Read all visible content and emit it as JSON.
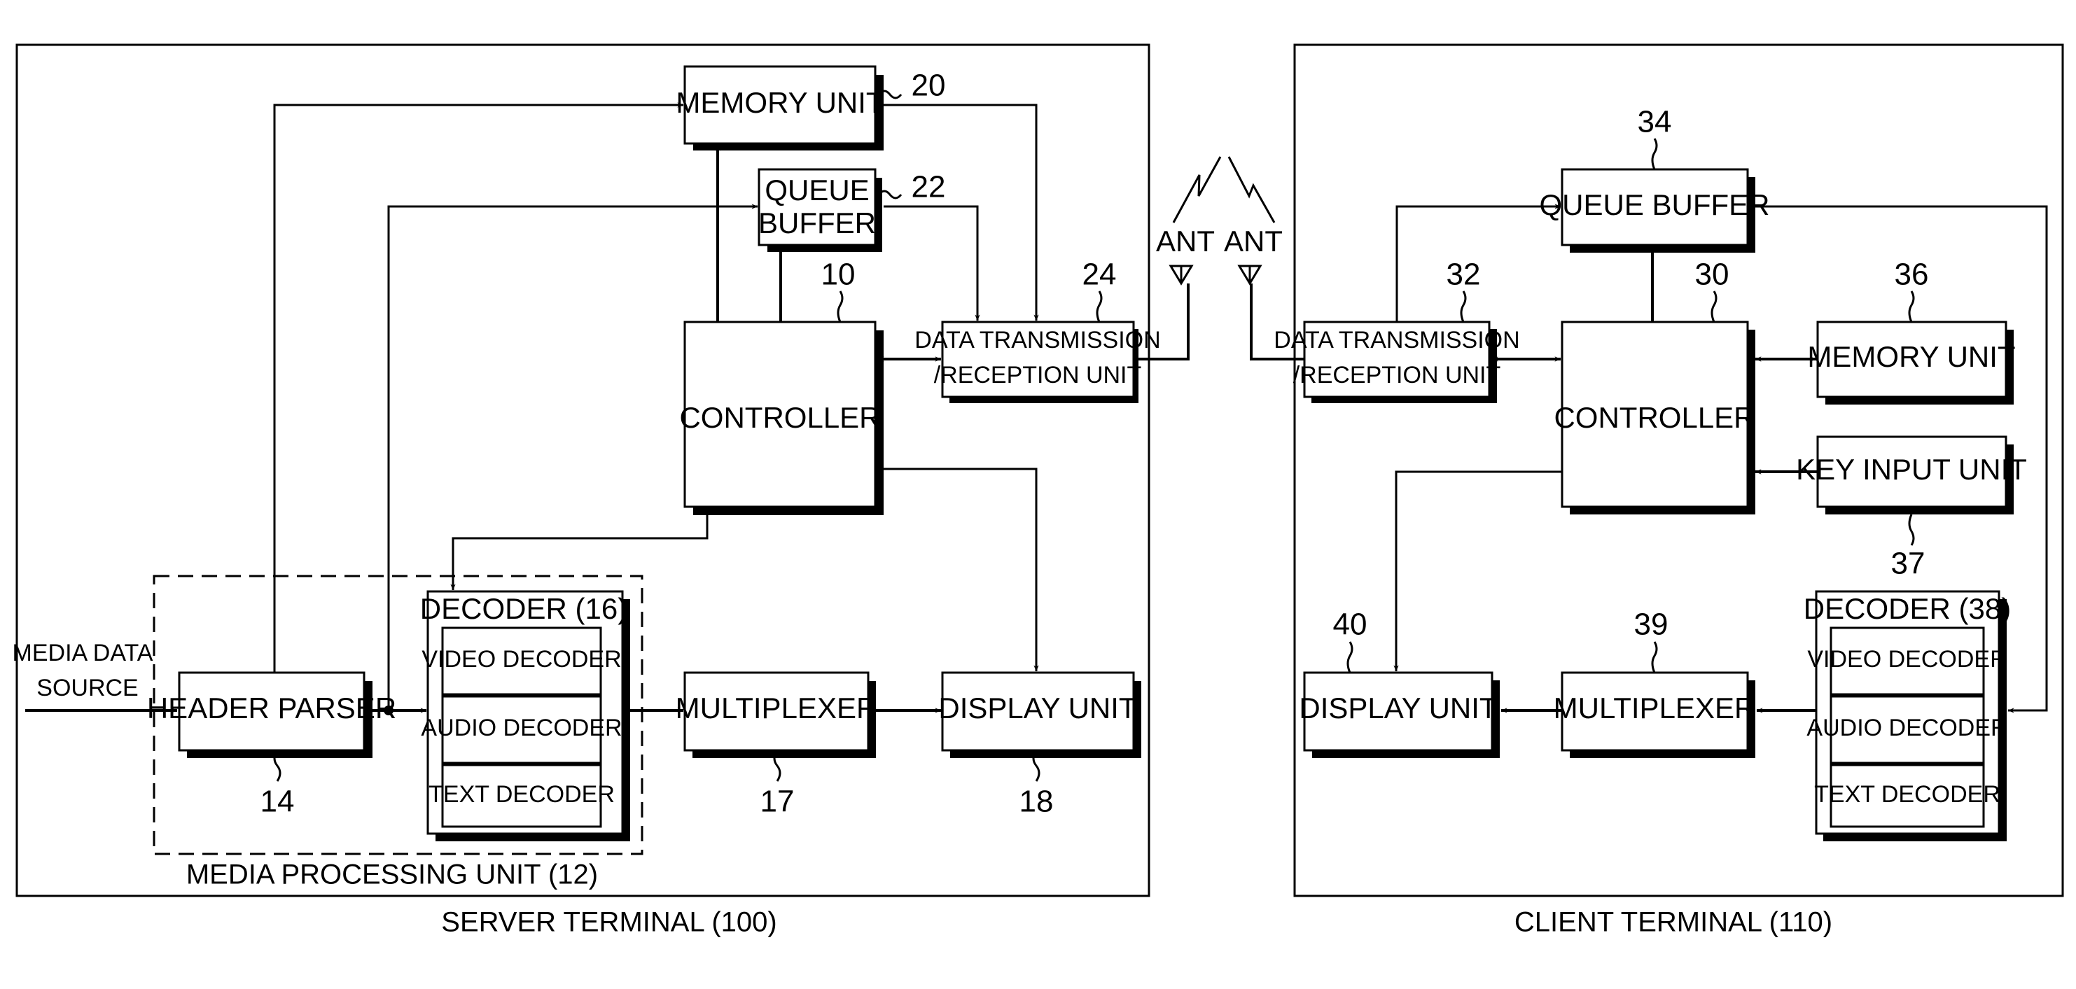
{
  "server": {
    "caption": "SERVER TERMINAL  (100)",
    "media_source": [
      "MEDIA DATA",
      "SOURCE"
    ],
    "memory_unit": {
      "label": "MEMORY UNIT",
      "ref": "20"
    },
    "queue_buffer": {
      "label": [
        "QUEUE",
        "BUFFER"
      ],
      "ref": "22"
    },
    "controller": {
      "label": "CONTROLLER",
      "ref": "10"
    },
    "data_tx": {
      "label": [
        "DATA TRANSMISSION",
        "/RECEPTION UNIT"
      ],
      "ref": "24"
    },
    "header_parser": {
      "label": "HEADER PARSER",
      "ref": "14"
    },
    "decoder": {
      "title": "DECODER (16)",
      "items": [
        "VIDEO DECODER",
        "AUDIO DECODER",
        "TEXT DECODER"
      ]
    },
    "media_processing_unit": "MEDIA PROCESSING UNIT (12)",
    "multiplexer": {
      "label": "MULTIPLEXER",
      "ref": "17"
    },
    "display_unit": {
      "label": "DISPLAY UNIT",
      "ref": "18"
    }
  },
  "antennas": {
    "left": "ANT",
    "right": "ANT"
  },
  "client": {
    "caption": "CLIENT TERMINAL  (110)",
    "data_tx": {
      "label": [
        "DATA TRANSMISSION",
        "/RECEPTION UNIT"
      ],
      "ref": "32"
    },
    "queue_buffer": {
      "label": "QUEUE BUFFER",
      "ref": "34"
    },
    "controller": {
      "label": "CONTROLLER",
      "ref": "30"
    },
    "memory_unit": {
      "label": "MEMORY UNIT",
      "ref": "36"
    },
    "key_input": {
      "label": "KEY INPUT UNIT",
      "ref": "37"
    },
    "decoder": {
      "title": "DECODER (38)",
      "items": [
        "VIDEO DECODER",
        "AUDIO DECODER",
        "TEXT DECODER"
      ]
    },
    "multiplexer": {
      "label": "MULTIPLEXER",
      "ref": "39"
    },
    "display_unit": {
      "label": "DISPLAY UNIT",
      "ref": "40"
    }
  }
}
